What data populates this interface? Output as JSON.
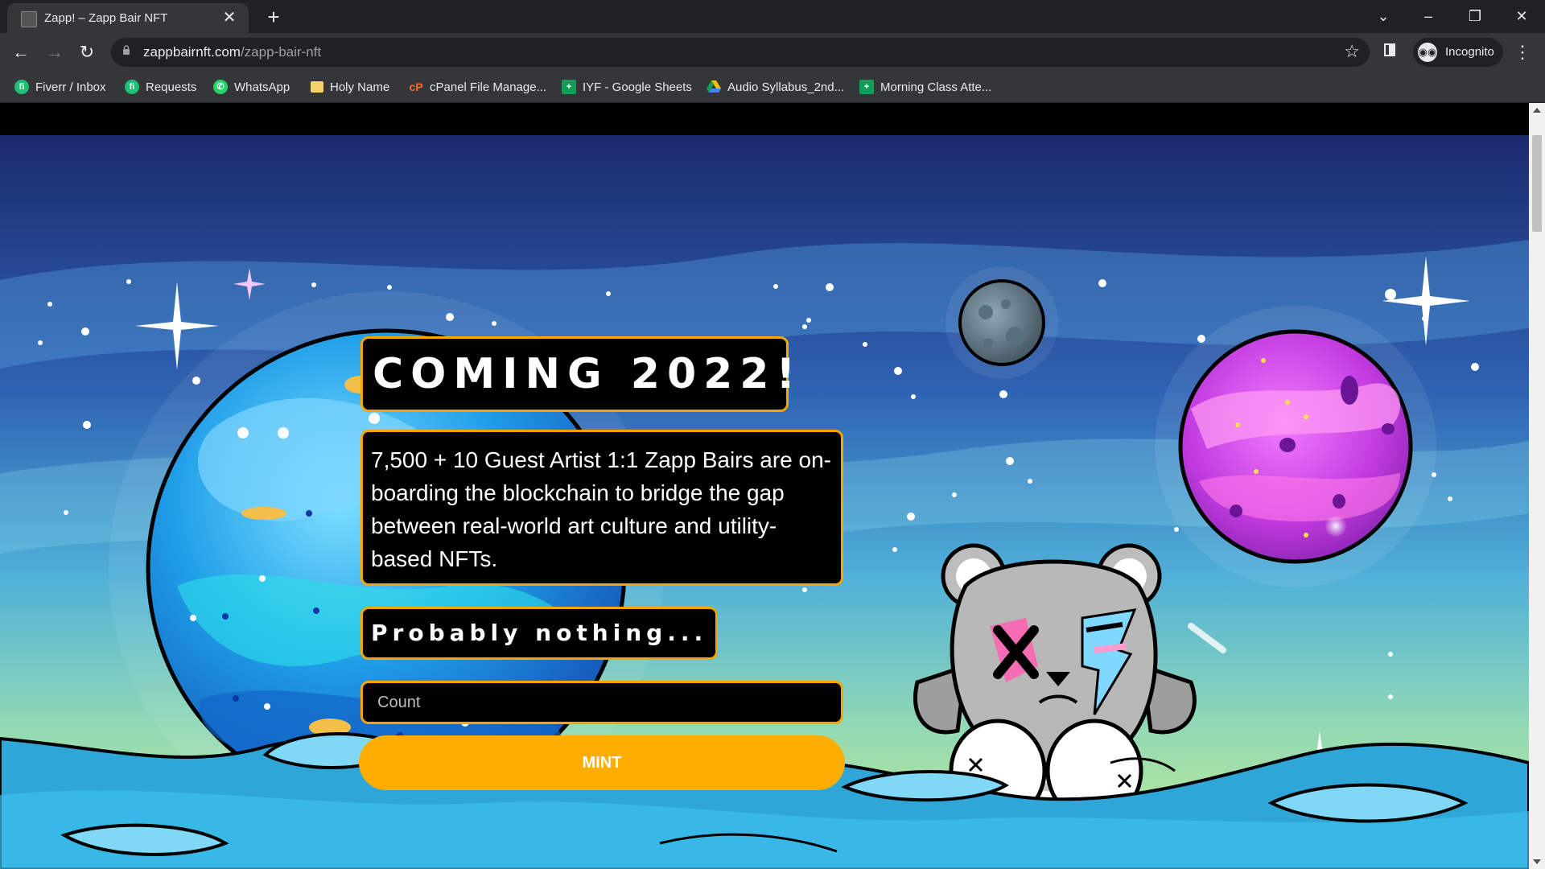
{
  "browser": {
    "tab_title": "Zapp! – Zapp Bair NFT",
    "url_host": "zappbairnft.com",
    "url_path": "/zapp-bair-nft",
    "profile_label": "Incognito"
  },
  "bookmarks": [
    {
      "label": "Fiverr / Inbox",
      "icon": "fiverr-icon",
      "color": "#1dbf73"
    },
    {
      "label": "Requests",
      "icon": "fiverr-icon",
      "color": "#1dbf73"
    },
    {
      "label": "WhatsApp",
      "icon": "whatsapp-icon",
      "color": "#25d366"
    },
    {
      "label": "Holy Name",
      "icon": "folder-icon",
      "color": "#f5d36b"
    },
    {
      "label": "cPanel File Manage...",
      "icon": "cpanel-icon",
      "color": "#ff6c2c"
    },
    {
      "label": "IYF - Google Sheets",
      "icon": "sheets-icon",
      "color": "#0f9d58"
    },
    {
      "label": "Audio Syllabus_2nd...",
      "icon": "drive-icon",
      "color": "#fbbc04"
    },
    {
      "label": "Morning Class Atte...",
      "icon": "sheets-icon",
      "color": "#0f9d58"
    }
  ],
  "page": {
    "heading": "COMING 2022!",
    "description": "7,500 + 10 Guest Artist 1:1 Zapp Bairs are on-boarding the blockchain to bridge the gap between real-world art culture and utility-based NFTs.",
    "tagline": "Probably nothing...",
    "count_placeholder": "Count",
    "mint_label": "MINT"
  },
  "colors": {
    "accent": "#f7a600",
    "mint_button": "#ffae00"
  }
}
